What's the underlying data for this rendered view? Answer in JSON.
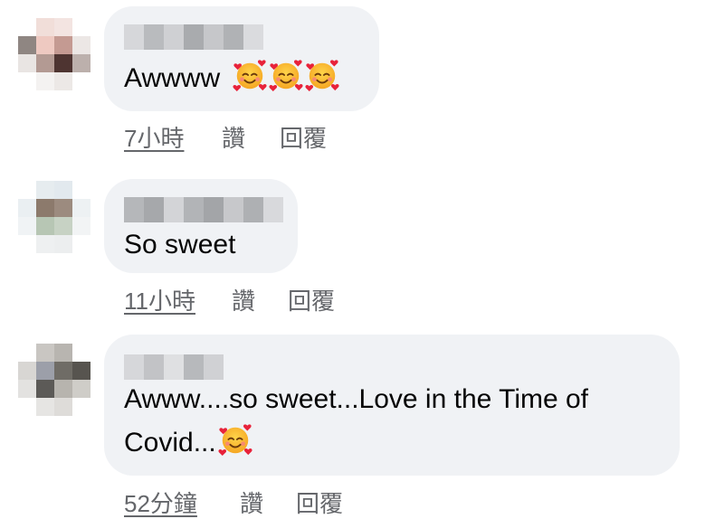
{
  "comments": [
    {
      "text": "Awwww",
      "emoji_count": 3,
      "emoji": "smiling-face-with-hearts-icon",
      "time": "7小時",
      "like": "讚",
      "reply": "回覆"
    },
    {
      "text": "So sweet",
      "emoji_count": 0,
      "time": "11小時",
      "like": "讚",
      "reply": "回覆"
    },
    {
      "line1": "Awww....so sweet...Love in the Time of",
      "line2": "Covid...",
      "emoji_count": 1,
      "emoji": "smiling-face-with-hearts-icon",
      "time": "52分鐘",
      "like": "讚",
      "reply": "回覆"
    }
  ],
  "colors": {
    "bubble": "#f0f2f5",
    "meta": "#65676b",
    "text": "#050505"
  }
}
